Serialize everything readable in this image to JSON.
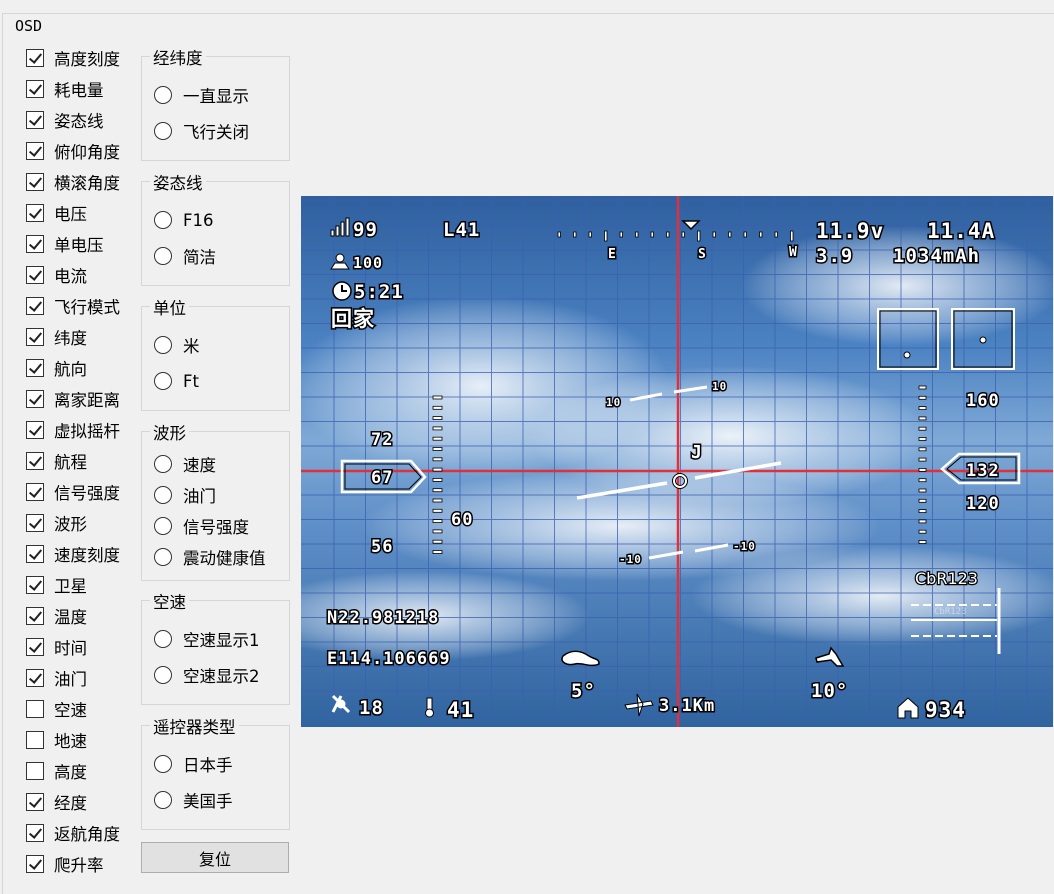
{
  "group_title": "OSD",
  "checkboxes": [
    {
      "label": "高度刻度",
      "checked": true
    },
    {
      "label": "耗电量",
      "checked": true
    },
    {
      "label": "姿态线",
      "checked": true
    },
    {
      "label": "俯仰角度",
      "checked": true
    },
    {
      "label": "横滚角度",
      "checked": true
    },
    {
      "label": "电压",
      "checked": true
    },
    {
      "label": "单电压",
      "checked": true
    },
    {
      "label": "电流",
      "checked": true
    },
    {
      "label": "飞行模式",
      "checked": true
    },
    {
      "label": "纬度",
      "checked": true
    },
    {
      "label": "航向",
      "checked": true
    },
    {
      "label": "离家距离",
      "checked": true
    },
    {
      "label": "虚拟摇杆",
      "checked": true
    },
    {
      "label": "航程",
      "checked": true
    },
    {
      "label": "信号强度",
      "checked": true
    },
    {
      "label": "波形",
      "checked": true
    },
    {
      "label": "速度刻度",
      "checked": true
    },
    {
      "label": "卫星",
      "checked": true
    },
    {
      "label": "温度",
      "checked": true
    },
    {
      "label": "时间",
      "checked": true
    },
    {
      "label": "油门",
      "checked": true
    },
    {
      "label": "空速",
      "checked": false
    },
    {
      "label": "地速",
      "checked": false
    },
    {
      "label": "高度",
      "checked": false
    },
    {
      "label": "经度",
      "checked": true
    },
    {
      "label": "返航角度",
      "checked": true
    },
    {
      "label": "爬升率",
      "checked": true
    }
  ],
  "groups": [
    {
      "title": "经纬度",
      "options": [
        "一直显示",
        "飞行关闭"
      ]
    },
    {
      "title": "姿态线",
      "options": [
        "F16",
        "简洁"
      ]
    },
    {
      "title": "单位",
      "options": [
        "米",
        "Ft"
      ]
    },
    {
      "title": "波形",
      "options": [
        "速度",
        "油门",
        "信号强度",
        "震动健康值"
      ]
    },
    {
      "title": "空速",
      "options": [
        "空速显示1",
        "空速显示2"
      ]
    },
    {
      "title": "遥控器类型",
      "options": [
        "日本手",
        "美国手"
      ]
    }
  ],
  "reset_label": "复位",
  "osd": {
    "signal": "99",
    "link_quality": "L41",
    "throttle": "100",
    "timer": "5:21",
    "flight_mode": "回家",
    "compass_e": "E",
    "compass_s": "S",
    "compass_w": "W",
    "voltage": "11.9v",
    "cell_voltage": "3.9",
    "current": "11.4A",
    "capacity": "1034mAh",
    "pitch_up": "10",
    "pitch_down": "-10",
    "speed_ticks": [
      "72",
      "67",
      "60",
      "56"
    ],
    "alt_ticks": [
      "160",
      "132",
      "120"
    ],
    "roll_marker": "J",
    "latitude": "N22.981218",
    "longitude": "E114.106669",
    "pitch_angle": "5°",
    "roll_angle": "10°",
    "trip_distance": "3.1Km",
    "satellites": "18",
    "temperature": "41",
    "home_distance": "934",
    "callsign": "CbR123",
    "wave_caption": "CbR123"
  },
  "colors": {
    "crosshair": "#e0303a",
    "hud_text": "#ffffff",
    "grid": "#3a5fb0"
  }
}
